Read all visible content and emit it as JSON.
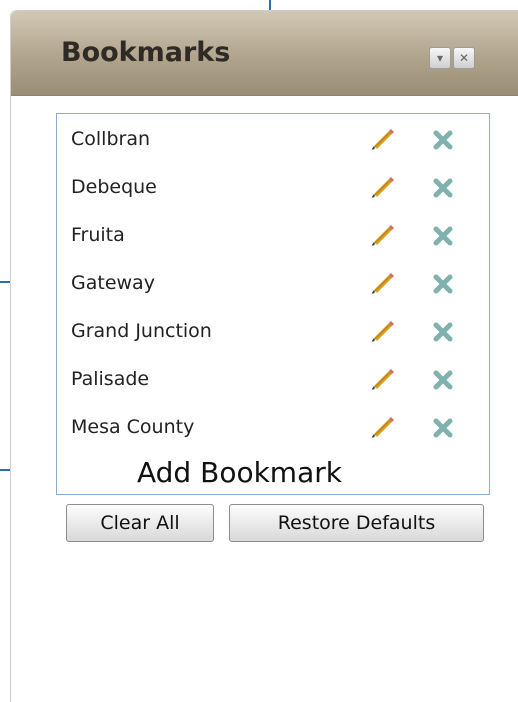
{
  "widget": {
    "title": "Bookmarks",
    "header_buttons": [
      {
        "icon": "chevron-down-icon",
        "glyph": "▾"
      },
      {
        "icon": "close-icon",
        "glyph": "✕"
      }
    ]
  },
  "bookmarks": [
    {
      "name": "Collbran"
    },
    {
      "name": "Debeque"
    },
    {
      "name": "Fruita"
    },
    {
      "name": "Gateway"
    },
    {
      "name": "Grand Junction"
    },
    {
      "name": "Palisade"
    },
    {
      "name": "Mesa County"
    }
  ],
  "add_bookmark_label": "Add Bookmark",
  "buttons": {
    "clear_all": "Clear All",
    "restore_defaults": "Restore Defaults"
  },
  "colors": {
    "header": "#b1a48d",
    "callout_line": "#2f6db0",
    "list_border": "#8aaecf",
    "delete_icon": "#7fb2ae",
    "pencil": "#e0a028"
  }
}
